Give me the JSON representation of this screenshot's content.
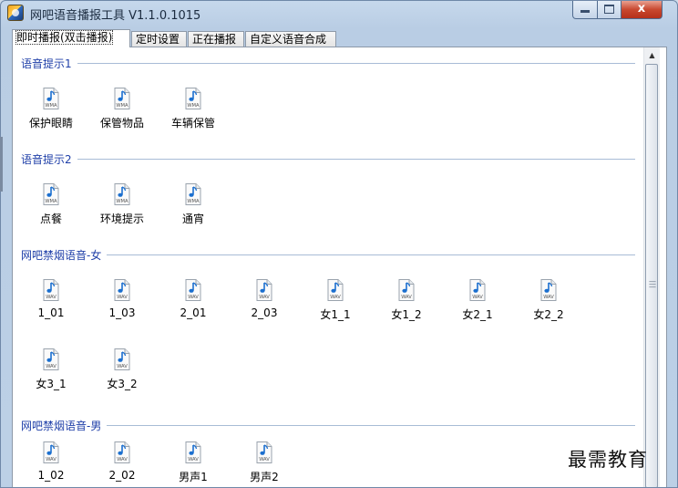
{
  "window": {
    "title": "网吧语音播报工具 V1.1.0.1015"
  },
  "controls": {
    "close_label": "x"
  },
  "tabs": [
    {
      "label": "即时播报(双击播报)",
      "active": true
    },
    {
      "label": "定时设置",
      "active": false
    },
    {
      "label": "正在播报",
      "active": false
    },
    {
      "label": "自定义语音合成",
      "active": false
    }
  ],
  "groups": [
    {
      "title": "语音提示1",
      "items": [
        {
          "type": "WMA",
          "label": "保护眼睛"
        },
        {
          "type": "WMA",
          "label": "保管物品"
        },
        {
          "type": "WMA",
          "label": "车辆保管"
        }
      ]
    },
    {
      "title": "语音提示2",
      "items": [
        {
          "type": "WMA",
          "label": "点餐"
        },
        {
          "type": "WMA",
          "label": "环境提示"
        },
        {
          "type": "WMA",
          "label": "通宵"
        }
      ]
    },
    {
      "title": "网吧禁烟语音-女",
      "items": [
        {
          "type": "WAV",
          "label": "1_01"
        },
        {
          "type": "WAV",
          "label": "1_03"
        },
        {
          "type": "WAV",
          "label": "2_01"
        },
        {
          "type": "WAV",
          "label": "2_03"
        },
        {
          "type": "WAV",
          "label": "女1_1"
        },
        {
          "type": "WAV",
          "label": "女1_2"
        },
        {
          "type": "WAV",
          "label": "女2_1"
        },
        {
          "type": "WAV",
          "label": "女2_2"
        },
        {
          "type": "WAV",
          "label": "女3_1"
        },
        {
          "type": "WAV",
          "label": "女3_2"
        }
      ]
    },
    {
      "title": "网吧禁烟语音-男",
      "items": [
        {
          "type": "WAV",
          "label": "1_02"
        },
        {
          "type": "WAV",
          "label": "2_02"
        },
        {
          "type": "WAV",
          "label": "男声1"
        },
        {
          "type": "WAV",
          "label": "男声2"
        }
      ]
    }
  ],
  "watermark": "最需教育",
  "colors": {
    "group_title": "#1f3fa8",
    "icon_note": "#1b6fcf",
    "close_button": "#c8482f"
  }
}
